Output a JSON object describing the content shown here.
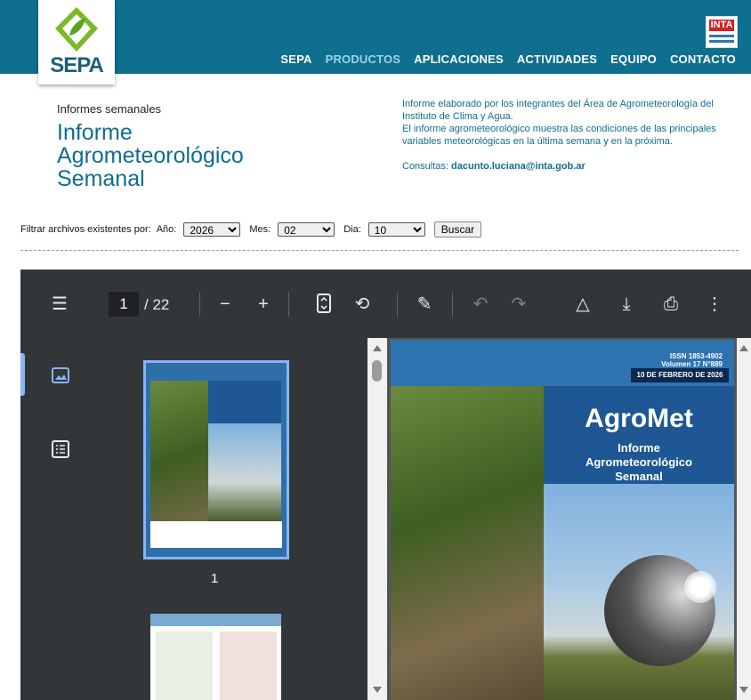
{
  "header": {
    "logo_text": "SEPA",
    "partner_logo": "INTA",
    "nav": [
      {
        "label": "SEPA",
        "active": false
      },
      {
        "label": "PRODUCTOS",
        "active": true
      },
      {
        "label": "APLICACIONES",
        "active": false
      },
      {
        "label": "ACTIVIDADES",
        "active": false
      },
      {
        "label": "EQUIPO",
        "active": false
      },
      {
        "label": "CONTACTO",
        "active": false
      }
    ]
  },
  "intro": {
    "subtitle": "Informes semanales",
    "title_line1": "Informe",
    "title_line2": "Agrometeorológico",
    "title_line3": "Semanal",
    "desc1": "Informe elaborado por los integrantes del Área de Agrometeorología del Instituto de Clima y Agua.",
    "desc2": "El informe agrometeorológico muestra las condiciones de las principales variables meteorológicas en la última semana y en la próxima.",
    "contact_label": "Consultas:",
    "contact_email": "dacunto.luciana@inta.gob.ar"
  },
  "filter": {
    "label": "Filtrar archivos existentes por:",
    "year_label": "Año:",
    "year_value": "2026",
    "month_label": "Mes:",
    "month_value": "02",
    "day_label": "Dia:",
    "day_value": "10",
    "search_button": "Buscar"
  },
  "viewer": {
    "current_page": "1",
    "total_pages": "/ 22",
    "thumb_page_label": "1",
    "icons": [
      "menu-icon",
      "zoom-out-icon",
      "zoom-in-icon",
      "fit-page-icon",
      "rotate-icon",
      "annotate-icon",
      "undo-icon",
      "redo-icon",
      "drive-icon",
      "download-icon",
      "print-icon",
      "more-icon",
      "thumbnails-icon",
      "outline-icon"
    ],
    "cover": {
      "issn": "ISSN 1853-4902",
      "volume": "Volumen 17 N°889",
      "date": "10 DE FEBRERO DE 2026",
      "title": "AgroMet",
      "subtitle_line1": "Informe",
      "subtitle_line2": "Agrometeorológico",
      "subtitle_line3": "Semanal"
    }
  },
  "colors": {
    "header_bg": "#0f6f8f",
    "accent_text": "#106d90",
    "viewer_toolbar": "#323639"
  }
}
